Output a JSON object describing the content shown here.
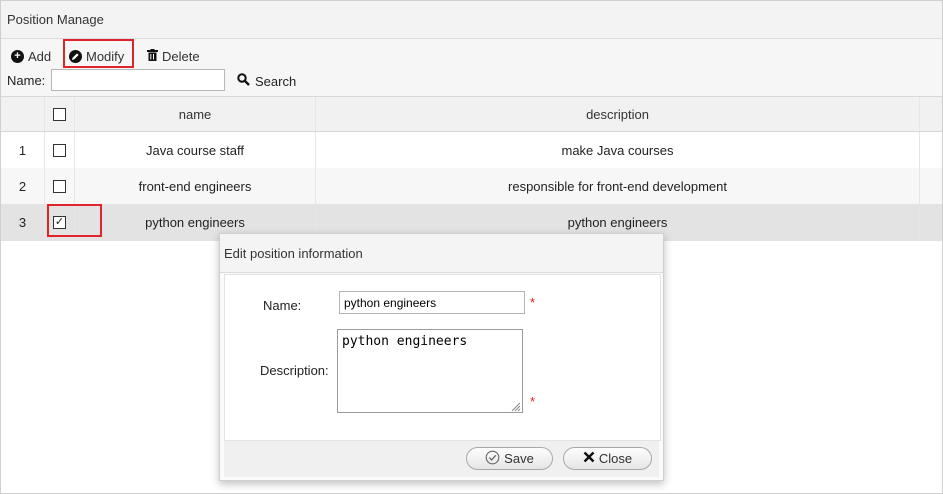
{
  "panel": {
    "title": "Position Manage"
  },
  "toolbar": {
    "add_label": "Add",
    "modify_label": "Modify",
    "delete_label": "Delete",
    "search_label": "Search",
    "name_label": "Name:",
    "name_value": ""
  },
  "grid": {
    "columns": [
      "name",
      "description"
    ],
    "rows": [
      {
        "num": "1",
        "checked": false,
        "name": "Java course staff",
        "description": "make Java courses"
      },
      {
        "num": "2",
        "checked": false,
        "name": "front-end engineers",
        "description": "responsible for front-end development"
      },
      {
        "num": "3",
        "checked": true,
        "name": "python engineers",
        "description": "python engineers"
      }
    ]
  },
  "dialog": {
    "title": "Edit position information",
    "name_label": "Name:",
    "name_value": "python engineers",
    "desc_label": "Description:",
    "desc_value": "python engineers",
    "required_mark": "*",
    "save_label": "Save",
    "close_label": "Close"
  },
  "colors": {
    "highlight": "#e0242b",
    "selected_row": "#e3e3e3",
    "required": "#e02020"
  },
  "icons": {
    "add": "plus-circle-icon",
    "modify": "pencil-circle-icon",
    "delete": "trash-icon",
    "search": "magnifier-icon",
    "save": "check-circle-icon",
    "close": "x-icon"
  }
}
